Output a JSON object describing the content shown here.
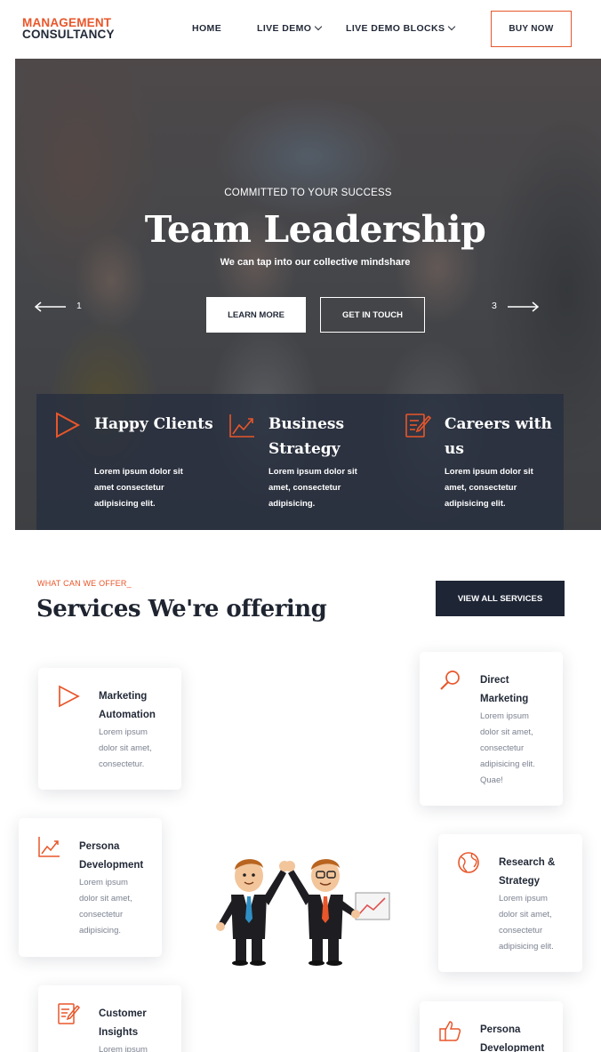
{
  "header": {
    "logo_line1": "MANAGEMENT",
    "logo_line2": "CONSULTANCY",
    "nav": [
      {
        "label": "HOME"
      },
      {
        "label": "LIVE DEMO"
      },
      {
        "label": "LIVE DEMO BLOCKS"
      }
    ],
    "buy_label": "BUY NOW"
  },
  "hero": {
    "kicker": "COMMITTED TO YOUR SUCCESS",
    "title": "Team Leadership",
    "subtitle": "We can tap into our collective mindshare",
    "learn_label": "LEARN MORE",
    "touch_label": "GET IN TOUCH",
    "prev_num": "1",
    "next_num": "3",
    "features": [
      {
        "title": "Happy Clients",
        "text": "Lorem ipsum dolor sit amet consectetur adipisicing elit.",
        "icon": "play-icon"
      },
      {
        "title": "Business Strategy",
        "text": "Lorem ipsum dolor sit amet, consectetur adipisicing.",
        "icon": "chart-line-icon"
      },
      {
        "title": "Careers with us",
        "text": "Lorem ipsum dolor sit amet, consectetur adipisicing elit.",
        "icon": "edit-document-icon"
      }
    ]
  },
  "services": {
    "kicker": "WHAT CAN WE OFFER_",
    "title": "Services We're offering",
    "view_all_label": "VIEW ALL SERVICES",
    "cards": [
      {
        "title": "Marketing Automation",
        "text": "Lorem ipsum dolor sit amet, consectetur.",
        "icon": "play-icon"
      },
      {
        "title": "Direct Marketing",
        "text": "Lorem ipsum dolor sit amet, consectetur adipisicing elit. Quae!",
        "icon": "search-icon"
      },
      {
        "title": "Persona Development",
        "text": "Lorem ipsum dolor sit amet, consectetur adipisicing.",
        "icon": "chart-line-icon"
      },
      {
        "title": "Research & Strategy",
        "text": "Lorem ipsum dolor sit amet, consectetur adipisicing elit.",
        "icon": "globe-icon"
      },
      {
        "title": "Customer Insights",
        "text": "Lorem ipsum",
        "icon": "edit-document-icon"
      },
      {
        "title": "Persona Development",
        "text": "",
        "icon": "thumbs-up-icon"
      }
    ]
  },
  "colors": {
    "accent": "#e8562a",
    "dark": "#1e2535",
    "text": "#232a38",
    "muted": "#7b8190"
  }
}
